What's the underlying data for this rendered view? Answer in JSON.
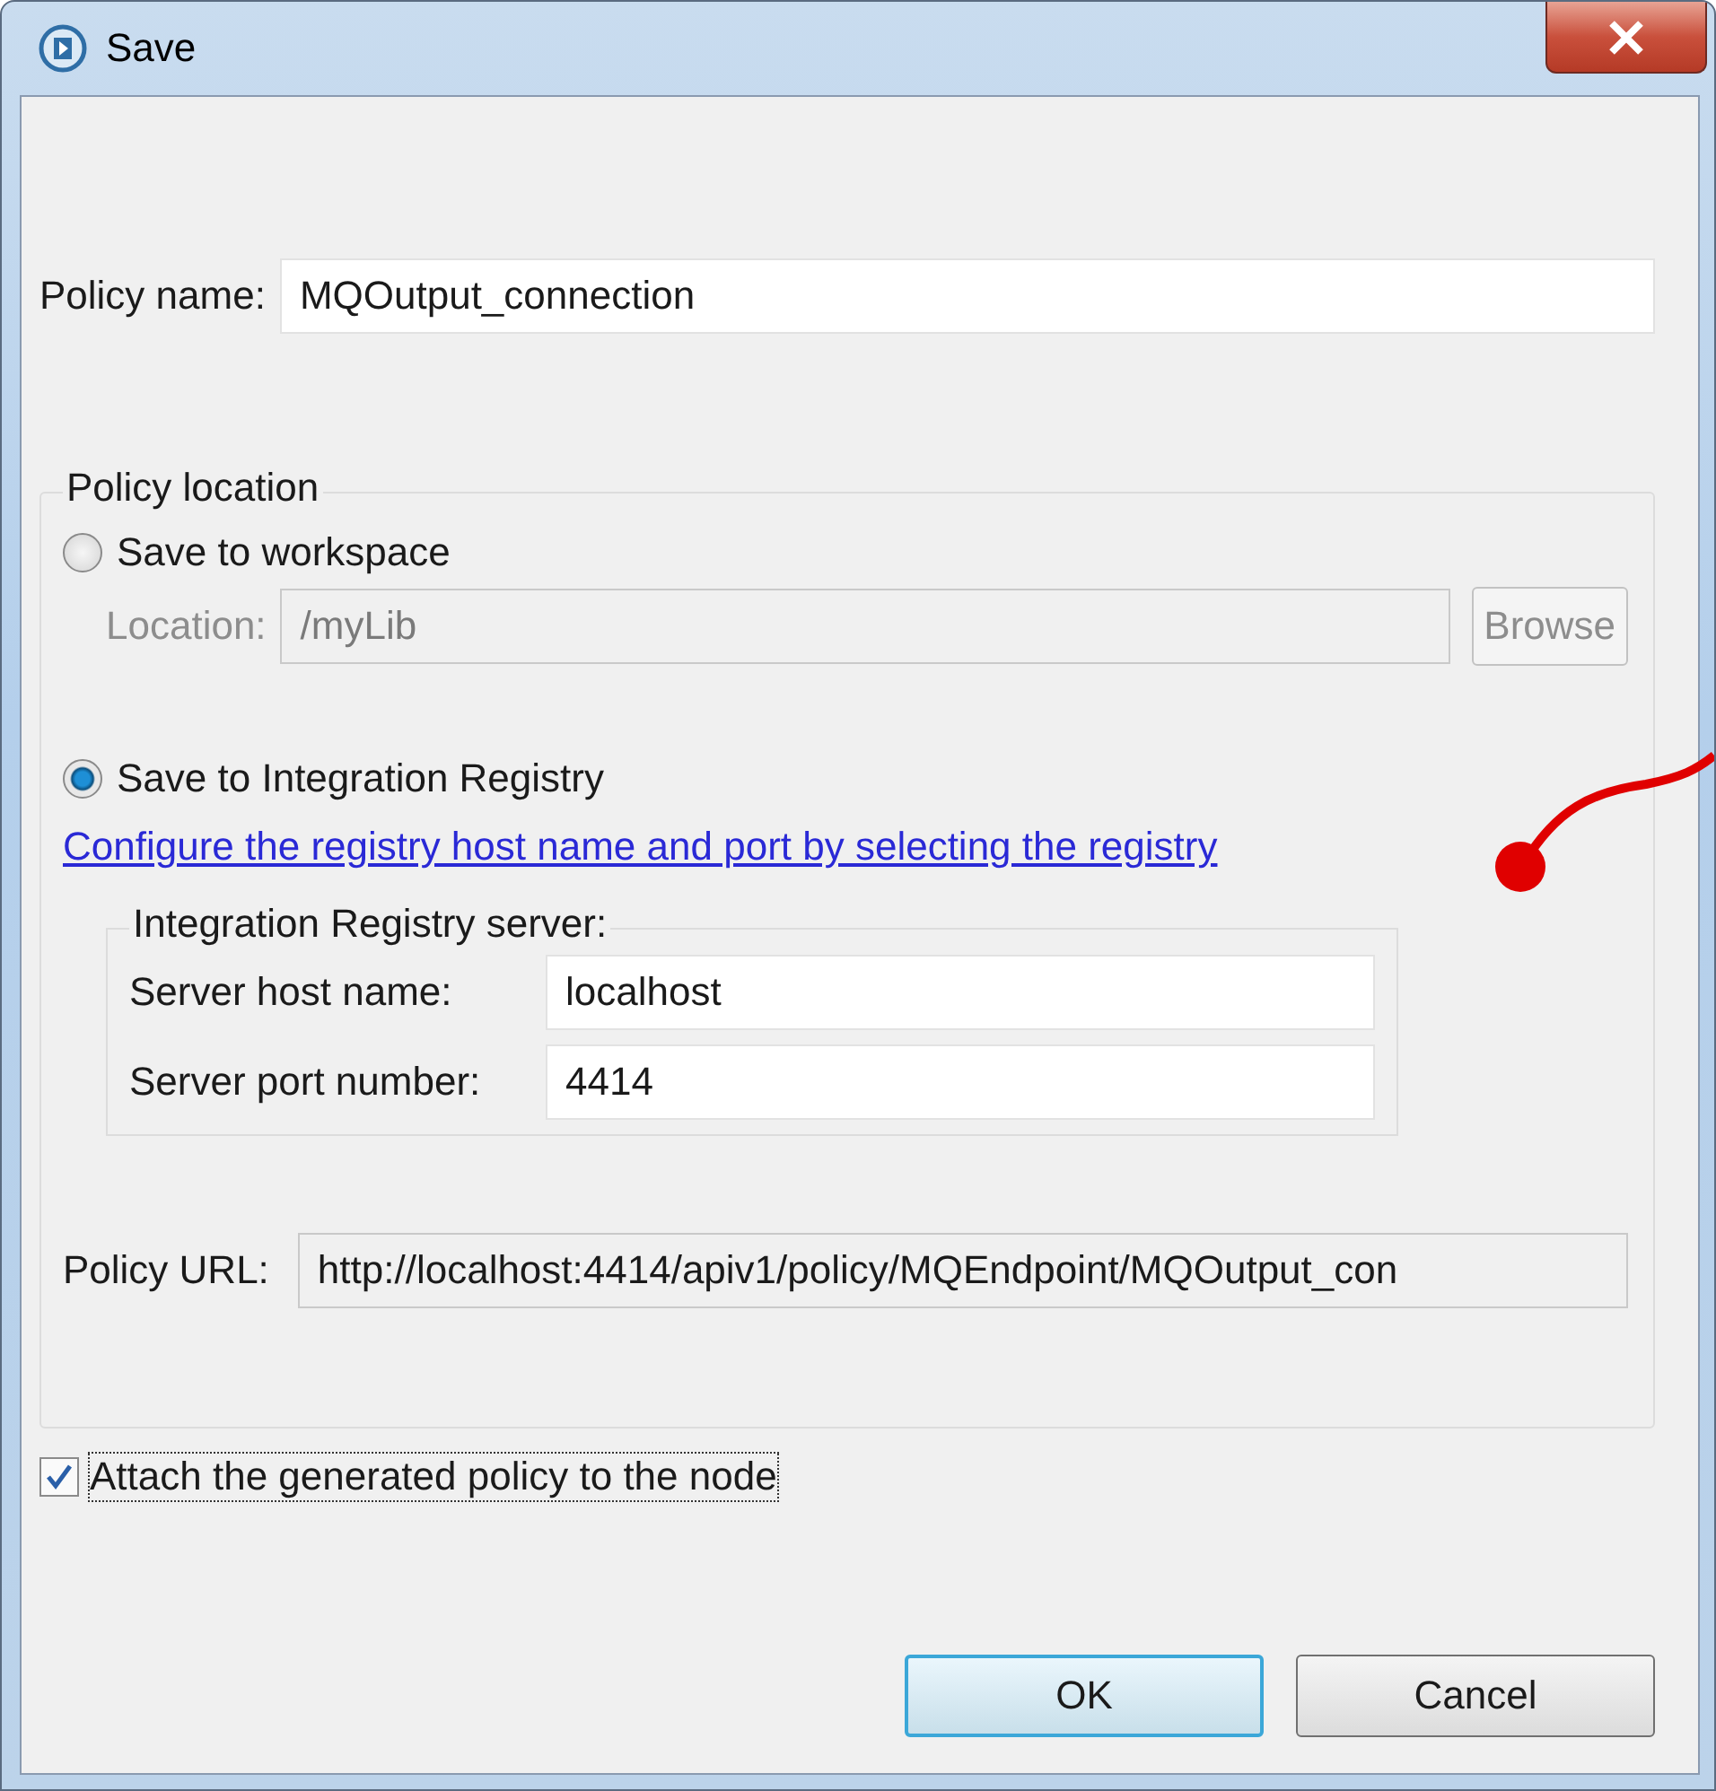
{
  "window": {
    "title": "Save"
  },
  "policy_name": {
    "label": "Policy name:",
    "value": "MQOutput_connection"
  },
  "policy_location": {
    "title": "Policy location",
    "options": [
      {
        "label": "Save to workspace",
        "selected": false
      },
      {
        "label": "Save to Integration Registry",
        "selected": true
      }
    ],
    "location": {
      "label": "Location:",
      "value": "/myLib",
      "disabled": true,
      "button": "Browse"
    },
    "link": "Configure the registry host name and port by selecting the registry",
    "server": {
      "title": "Integration Registry server:",
      "fields": [
        {
          "label": "Server host name:",
          "value": "localhost"
        },
        {
          "label": "Server port number:",
          "value": "4414"
        }
      ]
    },
    "policy_url": {
      "label": "Policy URL:",
      "value": "http://localhost:4414/apiv1/policy/MQEndpoint/MQOutput_con"
    }
  },
  "attach": {
    "label": "Attach the generated policy to the node",
    "checked": true
  },
  "buttons": [
    {
      "label": "OK",
      "default": true
    },
    {
      "label": "Cancel",
      "default": false
    }
  ]
}
